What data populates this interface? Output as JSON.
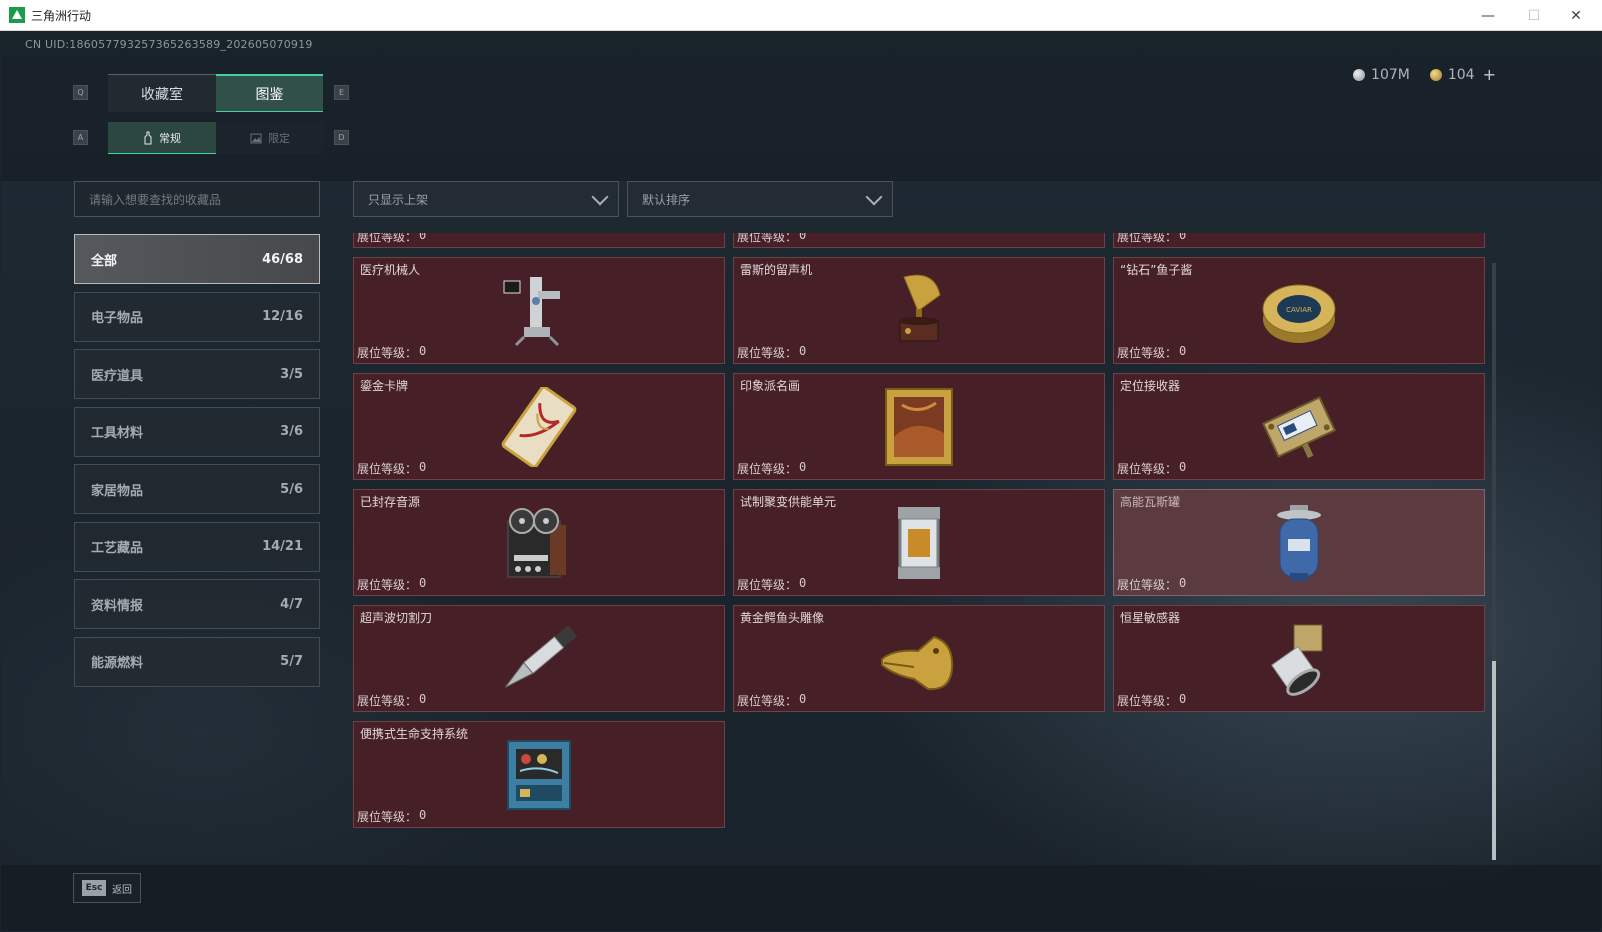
{
  "window": {
    "title": "三角洲行动",
    "minimize": "—",
    "maximize": "☐",
    "close": "✕"
  },
  "uid": "CN UID:18605779325736526358­9_202605070919",
  "currency": {
    "silver": "107M",
    "gold": "104",
    "add": "+"
  },
  "keys": {
    "tab_left": "Q",
    "tab_right": "E",
    "sub_left": "A",
    "sub_right": "D"
  },
  "tabs": [
    {
      "label": "收藏室"
    },
    {
      "label": "图鉴"
    }
  ],
  "subtabs": [
    {
      "label": "常规"
    },
    {
      "label": "限定"
    }
  ],
  "search": {
    "placeholder": "请输入想要查找的收藏品"
  },
  "filters": {
    "display": "只显示上架",
    "sort": "默认排序"
  },
  "categories": [
    {
      "label": "全部",
      "count": "46/68"
    },
    {
      "label": "电子物品",
      "count": "12/16"
    },
    {
      "label": "医疗道具",
      "count": "3/5"
    },
    {
      "label": "工具材料",
      "count": "3/6"
    },
    {
      "label": "家居物品",
      "count": "5/6"
    },
    {
      "label": "工艺藏品",
      "count": "14/21"
    },
    {
      "label": "资料情报",
      "count": "4/7"
    },
    {
      "label": "能源燃料",
      "count": "5/7"
    }
  ],
  "level_label": "展位等级：",
  "partial_row": [
    {
      "level": "0"
    },
    {
      "level": "0"
    },
    {
      "level": "0"
    }
  ],
  "items": [
    {
      "name": "医疗机械人",
      "level": "0",
      "icon": "medical-robot-icon"
    },
    {
      "name": "雷斯的留声机",
      "level": "0",
      "icon": "gramophone-icon"
    },
    {
      "name": "“钻石”鱼子酱",
      "level": "0",
      "icon": "caviar-tin-icon",
      "tin_text": "CAVIAR"
    },
    {
      "name": "鎏金卡牌",
      "level": "0",
      "icon": "gilded-card-icon"
    },
    {
      "name": "印象派名画",
      "level": "0",
      "icon": "painting-icon"
    },
    {
      "name": "定位接收器",
      "level": "0",
      "icon": "locator-receiver-icon"
    },
    {
      "name": "已封存音源",
      "level": "0",
      "icon": "tape-recorder-icon"
    },
    {
      "name": "试制聚变供能单元",
      "level": "0",
      "icon": "fusion-cell-icon"
    },
    {
      "name": "高能瓦斯罐",
      "level": "0",
      "icon": "gas-canister-icon"
    },
    {
      "name": "超声波切割刀",
      "level": "0",
      "icon": "ultrasonic-cutter-icon"
    },
    {
      "name": "黄金鳄鱼头雕像",
      "level": "0",
      "icon": "gold-crocodile-icon"
    },
    {
      "name": "恒星敏感器",
      "level": "0",
      "icon": "star-sensor-icon"
    },
    {
      "name": "便携式生命支持系统",
      "level": "0",
      "icon": "life-support-icon"
    }
  ],
  "bottom": {
    "esc_key": "Esc",
    "back_label": "返回"
  }
}
